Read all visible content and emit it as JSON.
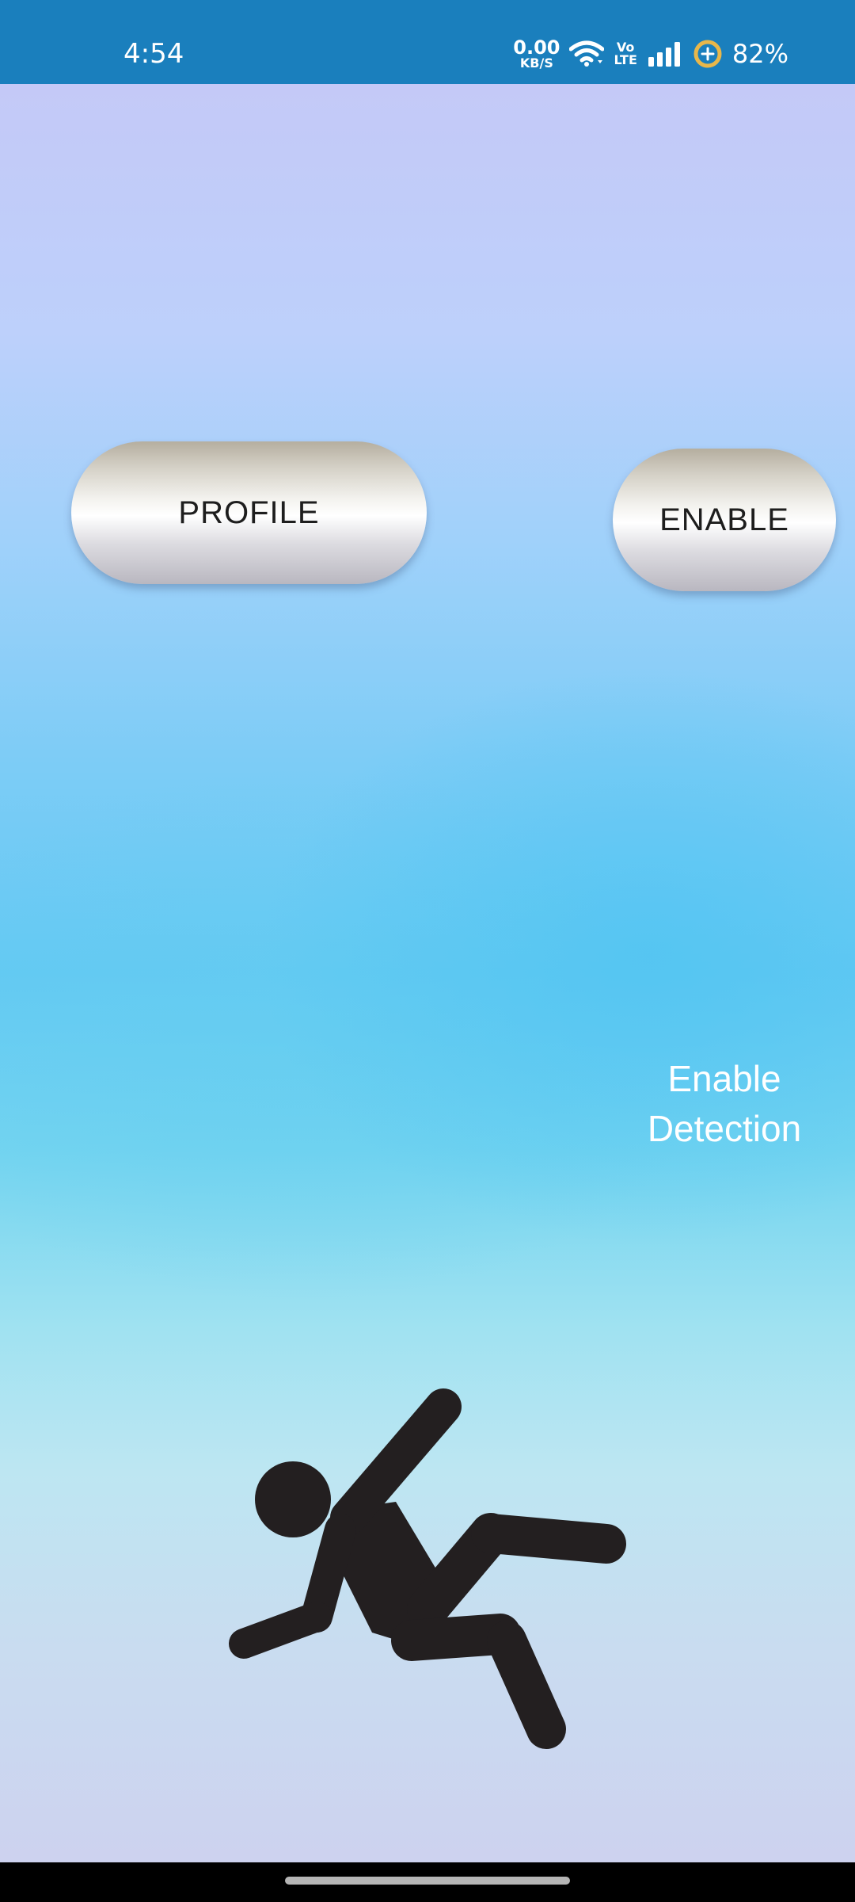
{
  "status_bar": {
    "time": "4:54",
    "net_speed_value": "0.00",
    "net_speed_unit": "KB/S",
    "volte_top": "Vo",
    "volte_bottom": "LTE",
    "battery": "82%",
    "icons": [
      "wifi-icon",
      "signal-icon",
      "battery-saver-icon"
    ]
  },
  "main": {
    "profile_label": "PROFILE",
    "enable_label": "ENABLE",
    "enable_detection_line1": "Enable",
    "enable_detection_line2": "Detection",
    "illustration": "falling-person-icon"
  },
  "colors": {
    "status_bar": "#1a7fbd",
    "figure": "#231f20",
    "caption_text": "#ffffff"
  }
}
